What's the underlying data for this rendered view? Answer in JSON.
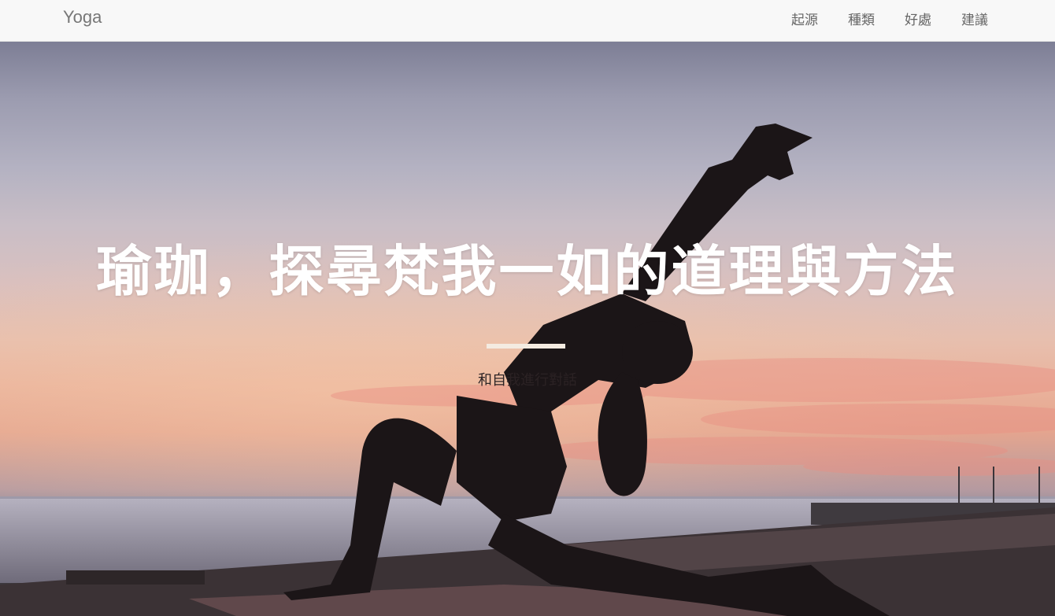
{
  "navbar": {
    "brand": "Yoga",
    "links": [
      "起源",
      "種類",
      "好處",
      "建議"
    ]
  },
  "hero": {
    "headline": "瑜珈，探尋梵我一如的道理與方法",
    "subtitle": "和自我進行對話",
    "divider_color": "#f4ebe1"
  }
}
